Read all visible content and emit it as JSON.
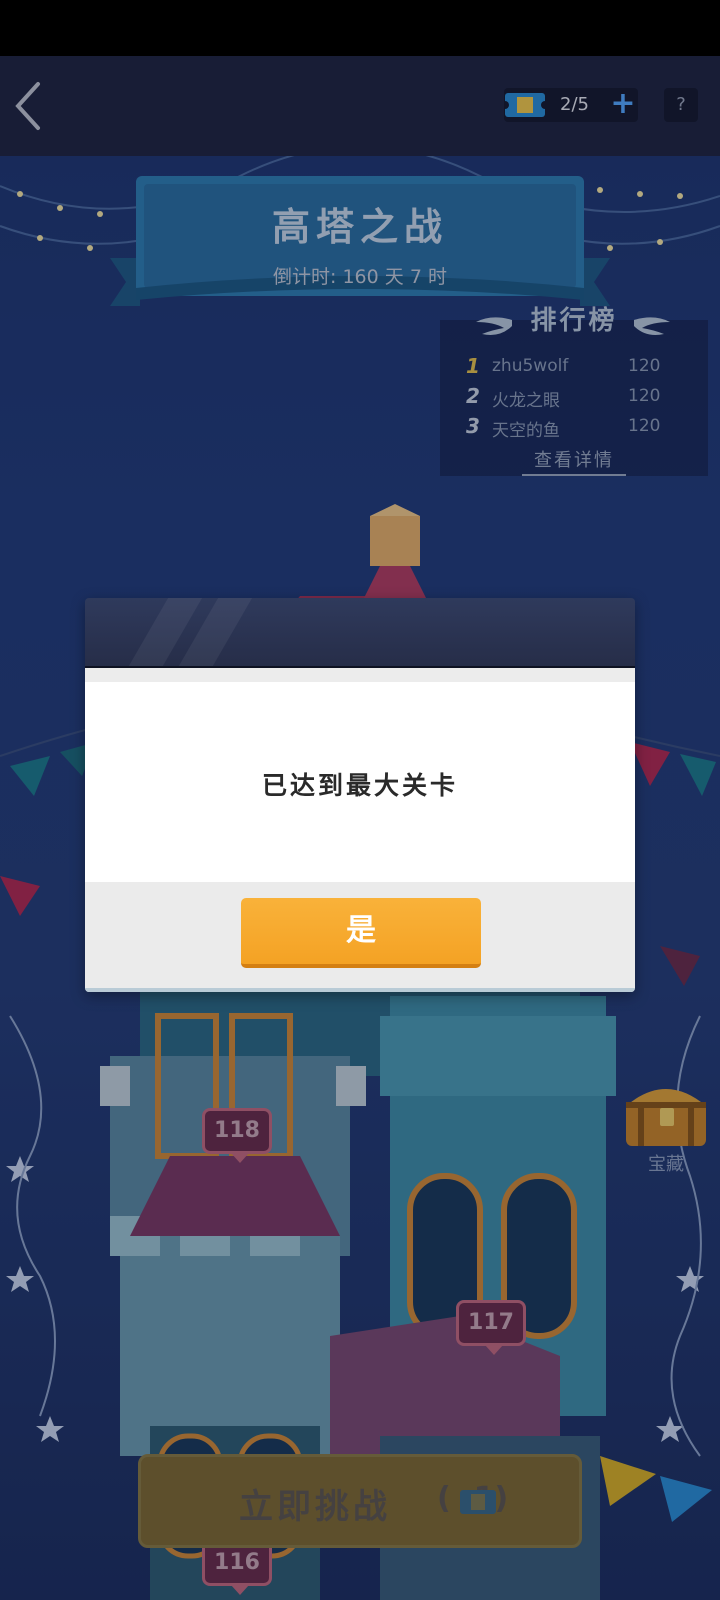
{
  "header": {
    "ticket_count": "2/5",
    "plus_label": "+",
    "help_label": "?"
  },
  "event": {
    "title": "高塔之战",
    "countdown": "倒计时: 160 天 7 时"
  },
  "leaderboard": {
    "title": "排行榜",
    "entries": [
      {
        "rank": "1",
        "name": "zhu5wolf",
        "score": "120"
      },
      {
        "rank": "2",
        "name": "火龙之眼",
        "score": "120"
      },
      {
        "rank": "3",
        "name": "天空的鱼",
        "score": "120"
      }
    ],
    "details_link": "查看详情"
  },
  "levels": {
    "upper": "118",
    "middle": "117",
    "lower": "116"
  },
  "treasure": {
    "label": "宝藏"
  },
  "challenge": {
    "label": "立即挑战",
    "cost": "( -1)"
  },
  "dialog": {
    "message": "已达到最大关卡",
    "confirm_label": "是"
  },
  "colors": {
    "accent": "#f4a224",
    "plus": "#55a8ff",
    "background": "#223c7a"
  }
}
